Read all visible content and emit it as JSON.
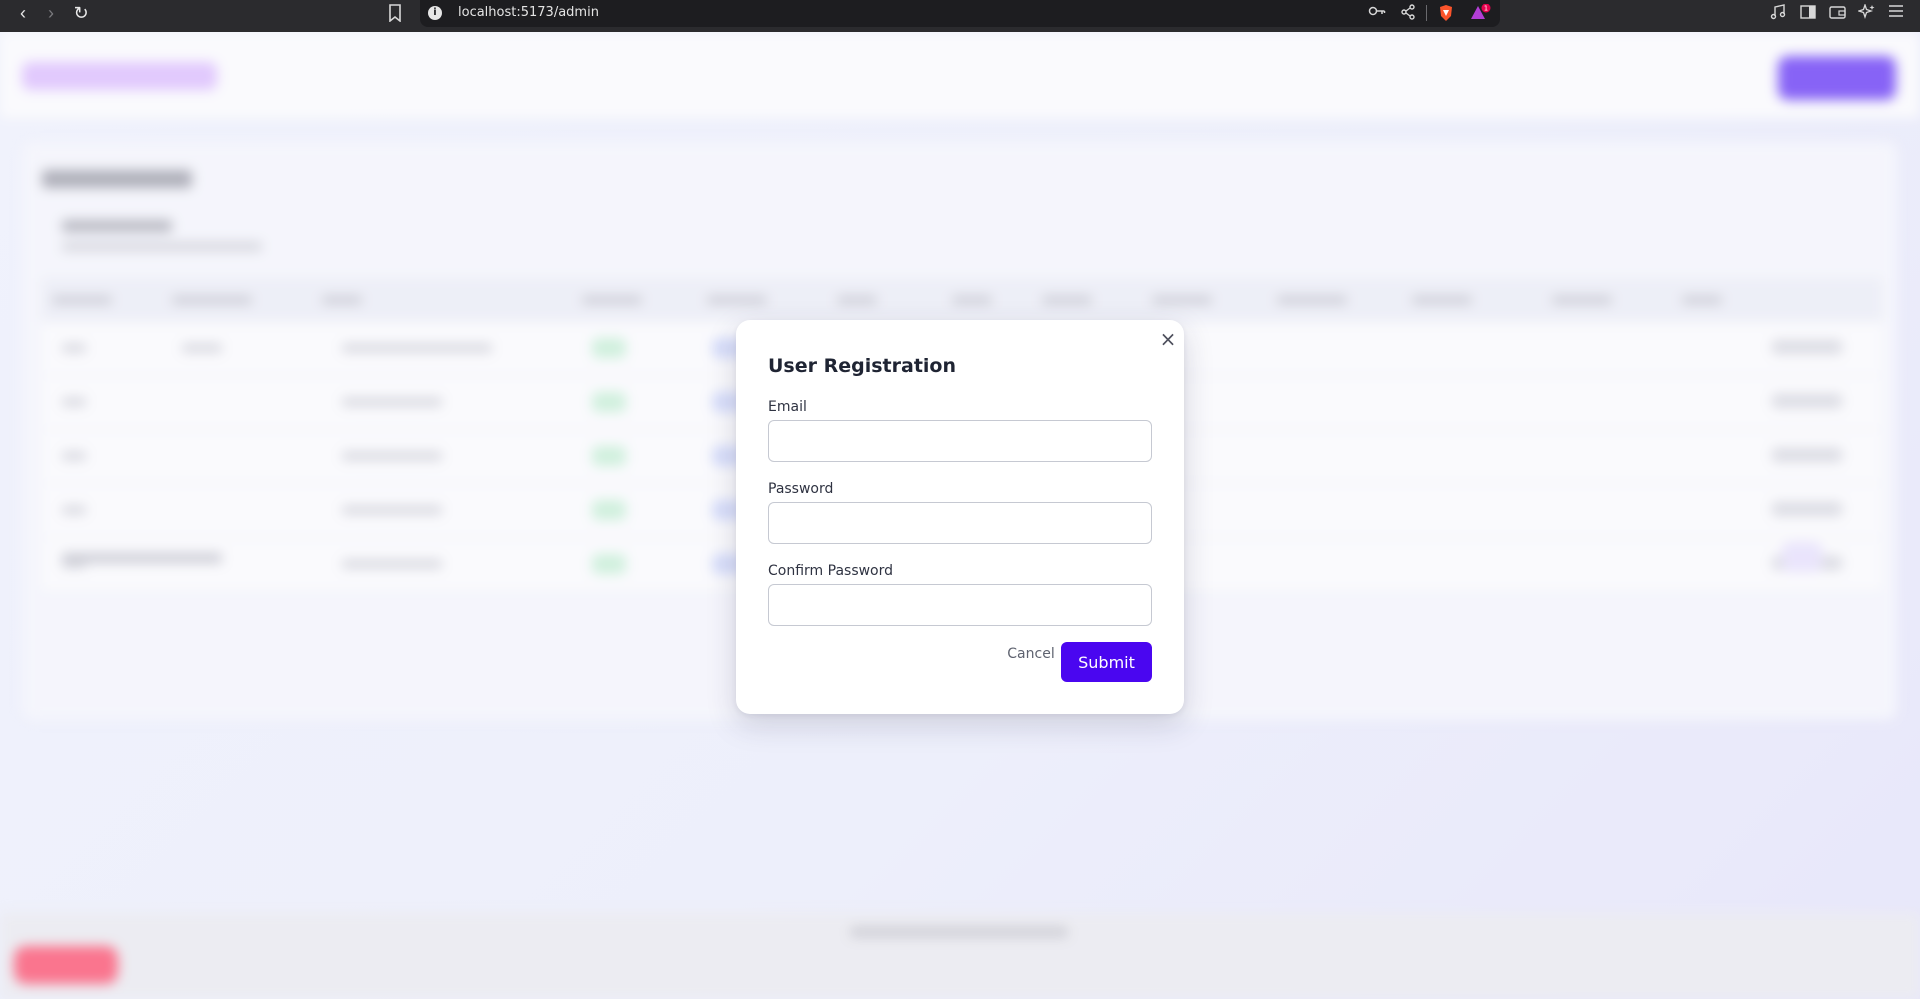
{
  "browser": {
    "url": "localhost:5173/admin",
    "info_glyph": "i",
    "back_glyph": "‹",
    "forward_glyph": "›",
    "reload_glyph": "↻",
    "icons": [
      "bookmark-icon",
      "key-icon",
      "share-icon",
      "brave-shield-icon",
      "brave-rewards-icon",
      "music-icon",
      "sidebar-icon",
      "wallet-icon",
      "leo-icon",
      "menu-icon"
    ]
  },
  "modal": {
    "title": "User Registration",
    "close_glyph": "×",
    "email_label": "Email",
    "email_value": "",
    "password_label": "Password",
    "password_value": "",
    "confirm_label": "Confirm Password",
    "confirm_value": "",
    "cancel_label": "Cancel",
    "submit_label": "Submit"
  },
  "colors": {
    "accent": "#4a06f0",
    "danger": "#ff3355",
    "logo": "#d9b4ff"
  }
}
